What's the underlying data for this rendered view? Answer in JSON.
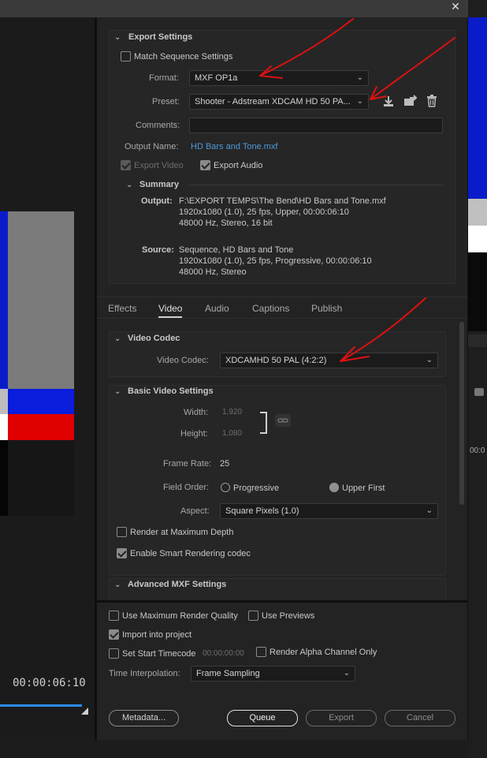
{
  "window": {
    "close_glyph": "✕"
  },
  "preview": {
    "timecode": "00:00:06:10"
  },
  "export_settings": {
    "section_title": "Export Settings",
    "match_sequence": {
      "label": "Match Sequence Settings",
      "checked": false
    },
    "format": {
      "label": "Format:",
      "value": "MXF OP1a"
    },
    "preset": {
      "label": "Preset:",
      "value": "Shooter - Adstream XDCAM HD 50 PA..."
    },
    "comments": {
      "label": "Comments:",
      "value": ""
    },
    "output_name": {
      "label": "Output Name:",
      "value": "HD Bars and Tone.mxf"
    },
    "export_video": {
      "label": "Export Video",
      "checked": true,
      "disabled": true
    },
    "export_audio": {
      "label": "Export Audio",
      "checked": true
    },
    "summary": {
      "title": "Summary",
      "output_label": "Output:",
      "output_lines": [
        "F:\\EXPORT TEMPS\\The Bend\\HD Bars and Tone.mxf",
        "1920x1080 (1.0), 25 fps, Upper, 00:00:06:10",
        "48000 Hz, Stereo, 16 bit"
      ],
      "source_label": "Source:",
      "source_lines": [
        "Sequence, HD Bars and Tone",
        "1920x1080 (1.0), 25 fps, Progressive, 00:00:06:10",
        "48000 Hz, Stereo"
      ]
    }
  },
  "tabs": [
    {
      "label": "Effects",
      "active": false
    },
    {
      "label": "Video",
      "active": true
    },
    {
      "label": "Audio",
      "active": false
    },
    {
      "label": "Captions",
      "active": false
    },
    {
      "label": "Publish",
      "active": false
    }
  ],
  "video_codec": {
    "section_title": "Video Codec",
    "label": "Video Codec:",
    "value": "XDCAMHD 50 PAL (4:2:2)"
  },
  "basic_video": {
    "section_title": "Basic Video Settings",
    "width_label": "Width:",
    "width_value": "1,920",
    "height_label": "Height:",
    "height_value": "1,080",
    "frame_rate_label": "Frame Rate:",
    "frame_rate_value": "25",
    "field_order_label": "Field Order:",
    "field_progressive": "Progressive",
    "field_upper": "Upper First",
    "aspect_label": "Aspect:",
    "aspect_value": "Square Pixels (1.0)",
    "render_max_depth": "Render at Maximum Depth",
    "smart_rendering": "Enable Smart Rendering codec"
  },
  "advanced_mxf": {
    "section_title": "Advanced MXF Settings"
  },
  "bottom": {
    "max_render_quality": "Use Maximum Render Quality",
    "use_previews": "Use Previews",
    "import_into_project": "Import into project",
    "set_start_timecode": "Set Start Timecode",
    "start_timecode_value": "00:00:00:00",
    "render_alpha": "Render Alpha Channel Only",
    "time_interp_label": "Time Interpolation:",
    "time_interp_value": "Frame Sampling",
    "metadata_button": "Metadata...",
    "queue_button": "Queue",
    "export_button": "Export",
    "cancel_button": "Cancel"
  },
  "colors": {
    "link": "#4c9bdb",
    "annotation_red": "#e01010",
    "scrub_blue": "#2d8ceb"
  }
}
